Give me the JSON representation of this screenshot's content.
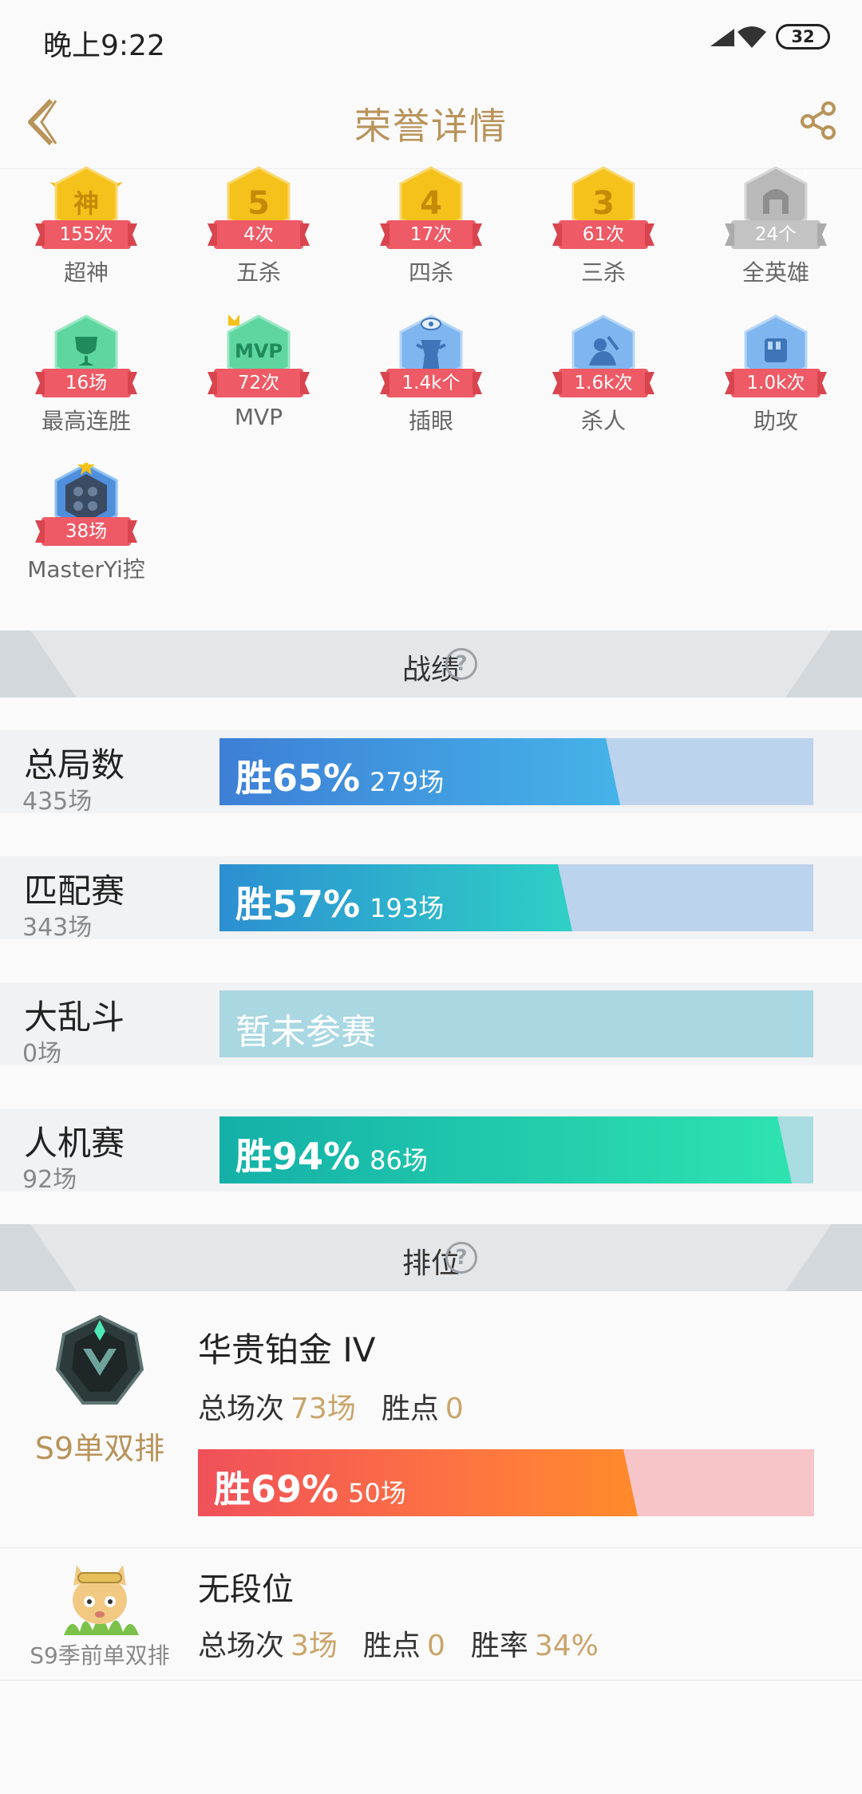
{
  "status": {
    "time": "晚上9:22",
    "battery": "32"
  },
  "header": {
    "title": "荣誉详情"
  },
  "honors": [
    {
      "count": "155次",
      "label": "超神",
      "badge": "神",
      "color": "#f5c21b"
    },
    {
      "count": "4次",
      "label": "五杀",
      "badge": "5",
      "color": "#f5c21b"
    },
    {
      "count": "17次",
      "label": "四杀",
      "badge": "4",
      "color": "#f5c21b"
    },
    {
      "count": "61次",
      "label": "三杀",
      "badge": "3",
      "color": "#f5c21b"
    },
    {
      "count": "24个",
      "label": "全英雄",
      "badge": "",
      "color": "#b9b9b9"
    },
    {
      "count": "16场",
      "label": "最高连胜",
      "badge": "",
      "color": "#5fd6a0"
    },
    {
      "count": "72次",
      "label": "MVP",
      "badge": "MVP",
      "color": "#5fd6a0"
    },
    {
      "count": "1.4k个",
      "label": "插眼",
      "badge": "",
      "color": "#7fb6ef"
    },
    {
      "count": "1.6k次",
      "label": "杀人",
      "badge": "",
      "color": "#7fb6ef"
    },
    {
      "count": "1.0k次",
      "label": "助攻",
      "badge": "",
      "color": "#7fb6ef"
    },
    {
      "count": "38场",
      "label": "MasterYi控",
      "badge": "",
      "color": "#4f8fdc"
    }
  ],
  "sections": {
    "record": "战绩",
    "rank": "排位",
    "help": "?"
  },
  "stats": [
    {
      "name": "总局数",
      "count": "435场",
      "win": "胜65%",
      "games": "279场",
      "rate": 0.65,
      "fill": "linear-gradient(90deg,#3d7fd6,#45b3e8)",
      "track": "#bcd3ee"
    },
    {
      "name": "匹配赛",
      "count": "343场",
      "win": "胜57%",
      "games": "193场",
      "rate": 0.57,
      "fill": "linear-gradient(90deg,#2c8fd2,#2fd0c6)",
      "track": "#bcd3ee"
    },
    {
      "name": "大乱斗",
      "count": "0场",
      "none": "暂未参赛",
      "rate": 0,
      "fill": "",
      "track": "#a9d7e2"
    },
    {
      "name": "人机赛",
      "count": "92场",
      "win": "胜94%",
      "games": "86场",
      "rate": 0.94,
      "fill": "linear-gradient(90deg,#14b0a8,#2ee3b0)",
      "track": "#a9dce0"
    }
  ],
  "rank1": {
    "season": "S9单双排",
    "title": "华贵铂金 IV",
    "total_label": "总场次",
    "total": "73场",
    "points_label": "胜点",
    "points": "0",
    "win": "胜69%",
    "games": "50场",
    "rate": 0.69
  },
  "rank2": {
    "season": "S9季前单双排",
    "title": "无段位",
    "total_label": "总场次",
    "total": "3场",
    "points_label": "胜点",
    "points": "0",
    "rate_label": "胜率",
    "winrate": "34%"
  }
}
